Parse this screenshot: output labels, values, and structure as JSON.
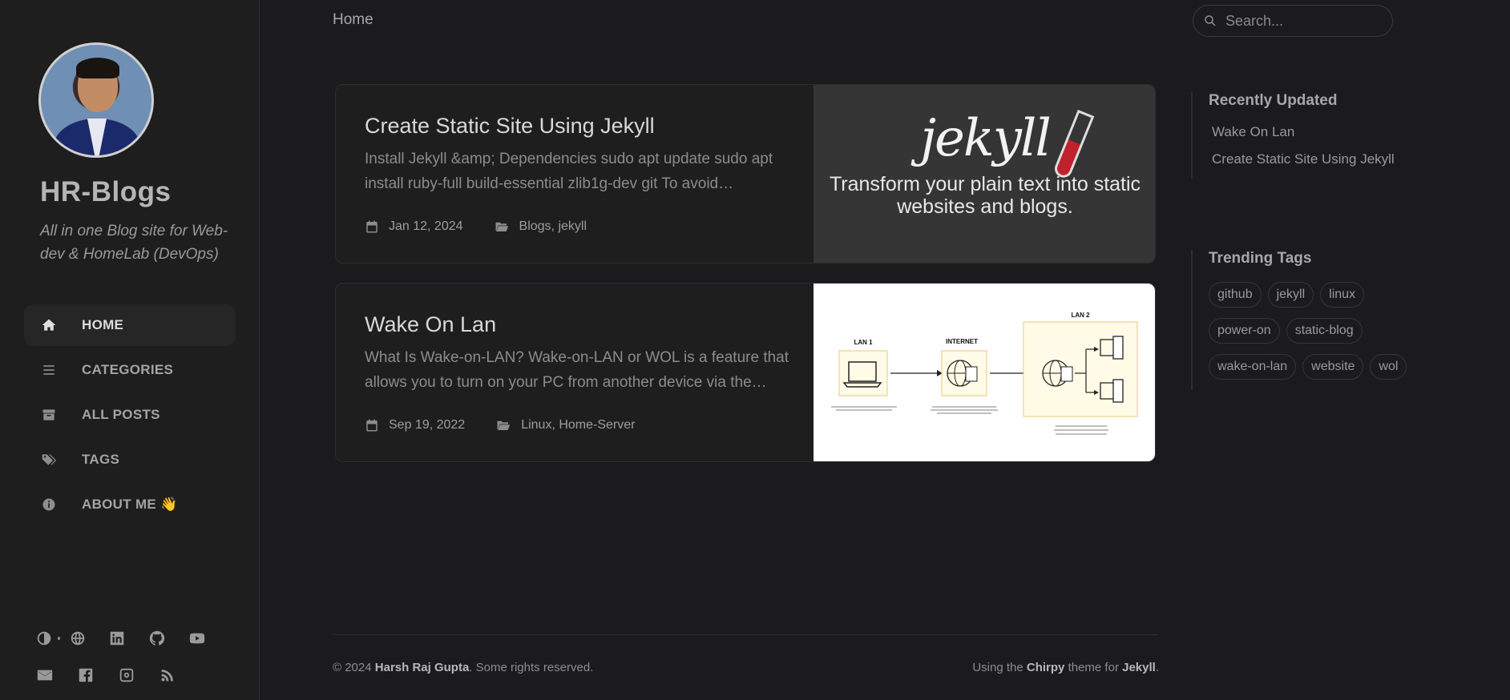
{
  "sidebar": {
    "site_title": "HR-Blogs",
    "site_subtitle": "All in one Blog site for Web-dev & HomeLab (DevOps)",
    "nav": [
      {
        "label": "HOME",
        "icon": "home-icon",
        "active": true
      },
      {
        "label": "CATEGORIES",
        "icon": "list-icon",
        "active": false
      },
      {
        "label": "ALL POSTS",
        "icon": "archive-icon",
        "active": false
      },
      {
        "label": "TAGS",
        "icon": "tags-icon",
        "active": false
      },
      {
        "label": "ABOUT ME 👋",
        "icon": "info-icon",
        "active": false
      }
    ],
    "social_icons": [
      "theme-toggle-icon",
      "globe-icon",
      "linkedin-icon",
      "github-icon",
      "youtube-icon",
      "email-icon",
      "facebook-icon",
      "instagram-icon",
      "rss-icon"
    ]
  },
  "topbar": {
    "breadcrumb": "Home",
    "search_placeholder": "Search..."
  },
  "posts": [
    {
      "title": "Create Static Site Using Jekyll",
      "excerpt": "Install Jekyll &amp; Dependencies sudo apt update sudo apt install ruby-full build-essential zlib1g-dev git To avoid…",
      "date": "Jan 12, 2024",
      "categories": "Blogs, jekyll",
      "image": {
        "logo_text": "jekyll",
        "tagline": "Transform your plain text into static websites and blogs."
      }
    },
    {
      "title": "Wake On Lan",
      "excerpt": "What Is Wake-on-LAN? Wake-on-LAN or WOL is a feature that allows you to turn on your PC from another device via the…",
      "date": "Sep 19, 2022",
      "categories": "Linux, Home-Server",
      "image": {
        "lan1": "LAN 1",
        "internet": "INTERNET",
        "lan2": "LAN 2"
      }
    }
  ],
  "panel": {
    "recent_heading": "Recently Updated",
    "recent": [
      "Wake On Lan",
      "Create Static Site Using Jekyll"
    ],
    "tags_heading": "Trending Tags",
    "tags": [
      "github",
      "jekyll",
      "linux",
      "power-on",
      "static-blog",
      "wake-on-lan",
      "website",
      "wol"
    ]
  },
  "footer": {
    "copyright_prefix": "© 2024 ",
    "author": "Harsh Raj Gupta",
    "rights": ". Some rights reserved.",
    "using": "Using the ",
    "theme": "Chirpy",
    "theme_for": " theme for ",
    "engine": "Jekyll",
    "end": "."
  }
}
